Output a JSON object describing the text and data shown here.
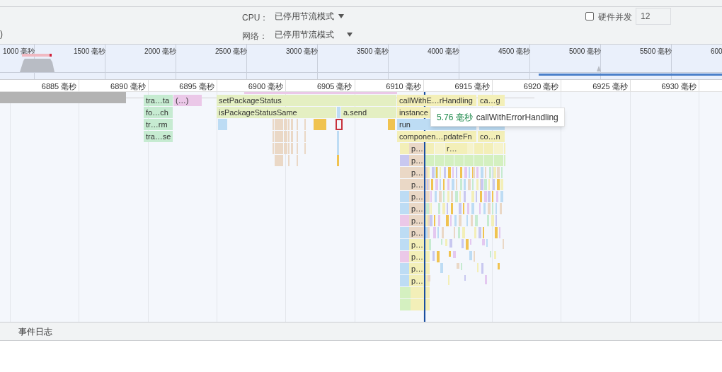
{
  "settings": {
    "cut_text": ")",
    "cpu": {
      "label": "CPU：",
      "value": "已停用节流模式"
    },
    "network": {
      "label": "网络：",
      "value": "已停用节流模式"
    },
    "hardware_concurrency": {
      "label": "硬件并发",
      "checked": false,
      "value": "12"
    }
  },
  "overview": {
    "ticks": [
      "1000 毫秒",
      "1500 毫秒",
      "2000 毫秒",
      "2500 毫秒",
      "3000 毫秒",
      "3500 毫秒",
      "4000 毫秒",
      "4500 毫秒",
      "5000 毫秒",
      "5500 毫秒",
      "600"
    ]
  },
  "ruler": {
    "ticks": [
      "6885 毫秒",
      "6890 毫秒",
      "6895 毫秒",
      "6900 毫秒",
      "6905 毫秒",
      "6910 毫秒",
      "6915 毫秒",
      "6920 毫秒",
      "6925 毫秒",
      "6930 毫秒"
    ]
  },
  "flame_chart": {
    "rows": [
      {
        "entries": [
          {
            "label": "tra…ta",
            "color": "#c6ebd1"
          },
          {
            "label": "(…)",
            "color": "#ebc8e8"
          },
          {
            "label": "setPackageStatus",
            "color": "#e4efc2"
          },
          {
            "label": "callWithE…rHandling",
            "color": "#f3efb8"
          },
          {
            "label": "ca…g",
            "color": "#f3efb8"
          }
        ]
      },
      {
        "entries": [
          {
            "label": "fo…ch",
            "color": "#c6ebd1"
          },
          {
            "label": "isPackageStatusSame",
            "color": "#e4efc2"
          },
          {
            "label": "a.send",
            "color": "#e4efc2"
          },
          {
            "label": "instance",
            "color": "#f3efb8"
          }
        ]
      },
      {
        "entries": [
          {
            "label": "tr…rm",
            "color": "#c6ebd1"
          },
          {
            "label": "run",
            "color": "#bddcf4"
          }
        ]
      },
      {
        "entries": [
          {
            "label": "tra…se",
            "color": "#c6ebd1"
          },
          {
            "label": "componen…pdateFn",
            "color": "#f3efb8"
          },
          {
            "label": "co…n",
            "color": "#f3efb8"
          }
        ]
      },
      {
        "entries": [
          {
            "label": "p…",
            "color": "#ead8c6"
          },
          {
            "label": "r…",
            "color": "#f3efb8"
          }
        ]
      },
      {
        "entries": [
          {
            "label": "p…",
            "color": "#ead8c6"
          }
        ]
      },
      {
        "entries": [
          {
            "label": "p…",
            "color": "#ead8c6"
          }
        ]
      },
      {
        "entries": [
          {
            "label": "p…",
            "color": "#ead8c6"
          }
        ]
      },
      {
        "entries": [
          {
            "label": "p…",
            "color": "#ead8c6"
          }
        ]
      },
      {
        "entries": [
          {
            "label": "p…",
            "color": "#ead8c6"
          }
        ]
      },
      {
        "entries": [
          {
            "label": "p…",
            "color": "#ead8c6"
          }
        ]
      },
      {
        "entries": [
          {
            "label": "p…",
            "color": "#ead8c6"
          }
        ]
      },
      {
        "entries": [
          {
            "label": "p…",
            "color": "#f3efb8"
          }
        ]
      },
      {
        "entries": [
          {
            "label": "p…",
            "color": "#f3efb8"
          }
        ]
      },
      {
        "entries": [
          {
            "label": "p…",
            "color": "#f3efb8"
          }
        ]
      },
      {
        "entries": [
          {
            "label": "p…",
            "color": "#f3efb8"
          }
        ]
      }
    ]
  },
  "tooltip": {
    "duration": "5.76 毫秒",
    "name": "callWithErrorHandling"
  },
  "bottom_tabs": [
    {
      "label": "事件日志",
      "selected": false
    }
  ]
}
